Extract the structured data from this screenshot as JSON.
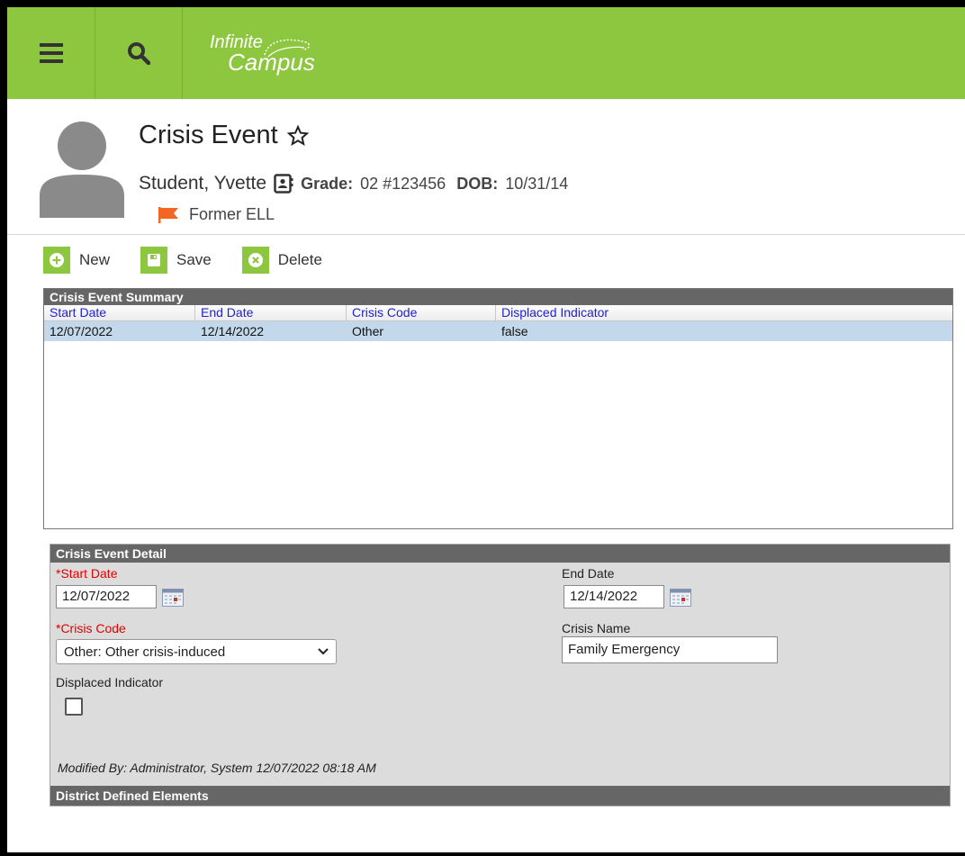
{
  "app": {
    "logo_line1": "Infinite",
    "logo_line2": "Campus",
    "brand_color": "#8dc63f"
  },
  "header": {
    "title": "Crisis Event",
    "student_name": "Student, Yvette",
    "grade_label": "Grade:",
    "grade_value": "02 #123456",
    "dob_label": "DOB:",
    "dob_value": "10/31/14",
    "flag_label": "Former ELL",
    "flag_color": "#f26522"
  },
  "toolbar": {
    "new_label": "New",
    "save_label": "Save",
    "delete_label": "Delete"
  },
  "summary": {
    "title": "Crisis Event Summary",
    "columns": [
      "Start Date",
      "End Date",
      "Crisis Code",
      "Displaced Indicator"
    ],
    "rows": [
      [
        "12/07/2022",
        "12/14/2022",
        "Other",
        "false"
      ]
    ]
  },
  "detail": {
    "title": "Crisis Event Detail",
    "start_date_label": "*Start Date",
    "start_date_value": "12/07/2022",
    "end_date_label": "End Date",
    "end_date_value": "12/14/2022",
    "crisis_code_label": "*Crisis Code",
    "crisis_code_value": "Other: Other crisis-induced",
    "crisis_name_label": "Crisis Name",
    "crisis_name_value": "Family Emergency",
    "displaced_label": "Displaced Indicator",
    "modified_text": "Modified By: Administrator, System 12/07/2022 08:18 AM",
    "district_title": "District Defined Elements"
  }
}
